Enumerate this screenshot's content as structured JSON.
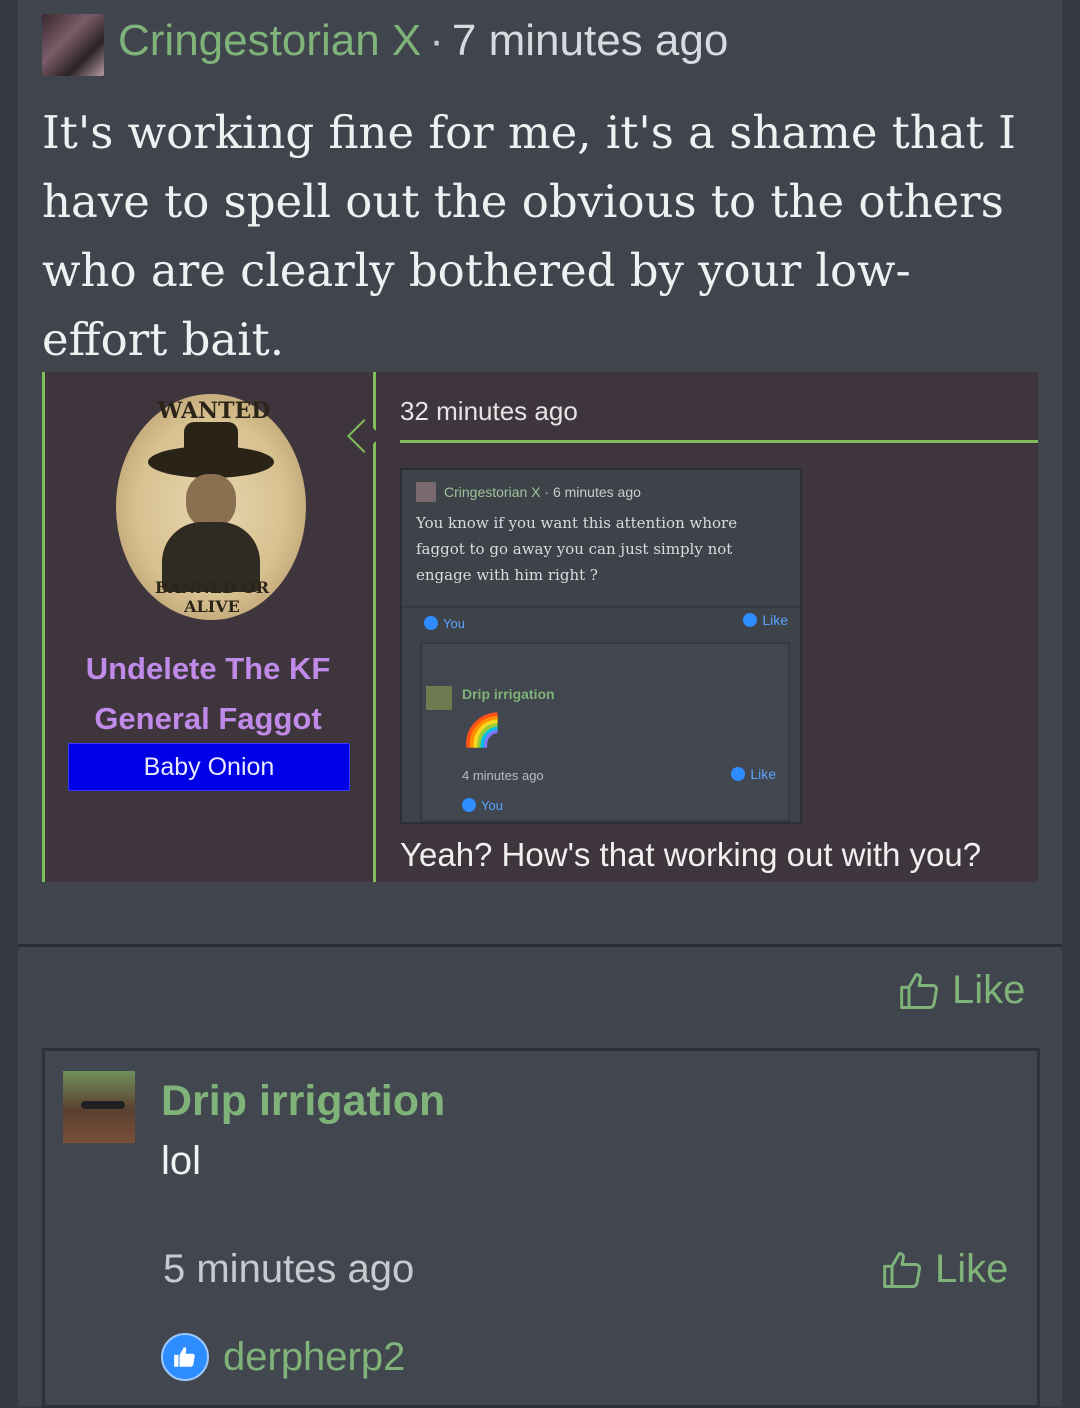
{
  "post": {
    "author": "Cringestorian X",
    "separator": "·",
    "time": "7 minutes ago",
    "body": "It's working fine for me, it's a shame that I have to spell out the obvious to the others who are clearly bothered by your low-effort bait.",
    "like_label": "Like"
  },
  "quote": {
    "wanted_top": "WANTED",
    "wanted_bottom": "BANNED OR ALIVE",
    "user_title": "Undelete The KF General Faggot",
    "user_badge": "Baby Onion",
    "time": "32 minutes ago",
    "text": "Yeah? How's that working out with you?",
    "inner": {
      "author": "Cringestorian X",
      "meta": " · 6 minutes ago",
      "body": "You know if you want this attention whore faggot to go away you can just simply not engage with him right ?",
      "like": "Like",
      "you": "You",
      "reply_author": "Drip irrigation",
      "reply_emoji": "🌈",
      "reply_time": "4 minutes ago",
      "reply_like": "Like",
      "reply_you": "You"
    }
  },
  "reply": {
    "author": "Drip irrigation",
    "text": "lol",
    "time": "5 minutes ago",
    "like_label": "Like",
    "liked_by": "derpherp2"
  },
  "colors": {
    "accent_green": "#7fb37a",
    "badge_blue": "#0000e6",
    "title_purple": "#c08ae8"
  }
}
